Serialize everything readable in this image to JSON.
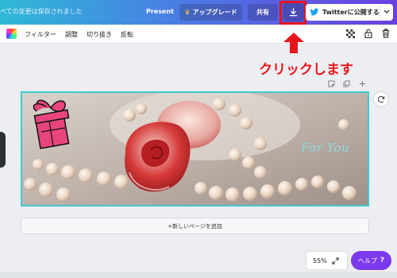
{
  "header": {
    "saved_status": "べての変更は保存されました",
    "present_label": "Present",
    "upgrade_label": "アップグレード",
    "share_label": "共有",
    "twitter_label": "Twitterに公開する"
  },
  "toolbar": {
    "filter_label": "フィルター",
    "adjust_label": "調整",
    "crop_label": "切り抜き",
    "flip_label": "反転"
  },
  "canvas": {
    "image_text": "For You",
    "add_page_label": "+新しいページを追加"
  },
  "footer": {
    "zoom_label": "55%",
    "help_label": "ヘルプ",
    "help_symbol": "?"
  },
  "annotation": {
    "text": "クリックします"
  },
  "colors": {
    "highlight": "#e8141a",
    "help_button": "#7c3aed",
    "page_border": "#3ec9d3"
  }
}
